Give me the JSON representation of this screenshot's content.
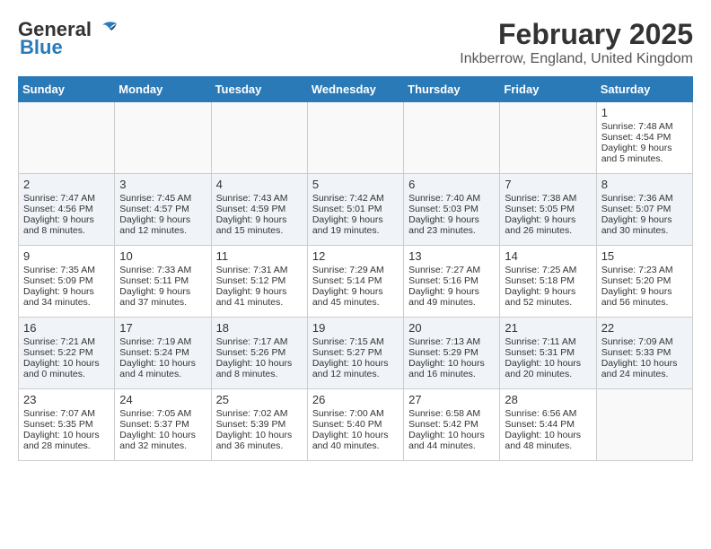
{
  "header": {
    "logo_general": "General",
    "logo_blue": "Blue",
    "title": "February 2025",
    "subtitle": "Inkberrow, England, United Kingdom"
  },
  "days_of_week": [
    "Sunday",
    "Monday",
    "Tuesday",
    "Wednesday",
    "Thursday",
    "Friday",
    "Saturday"
  ],
  "weeks": [
    [
      {
        "day": "",
        "empty": true
      },
      {
        "day": "",
        "empty": true
      },
      {
        "day": "",
        "empty": true
      },
      {
        "day": "",
        "empty": true
      },
      {
        "day": "",
        "empty": true
      },
      {
        "day": "",
        "empty": true
      },
      {
        "day": "1",
        "sunrise": "7:48 AM",
        "sunset": "4:54 PM",
        "daylight": "9 hours and 5 minutes."
      }
    ],
    [
      {
        "day": "2",
        "sunrise": "7:47 AM",
        "sunset": "4:56 PM",
        "daylight": "9 hours and 8 minutes."
      },
      {
        "day": "3",
        "sunrise": "7:45 AM",
        "sunset": "4:57 PM",
        "daylight": "9 hours and 12 minutes."
      },
      {
        "day": "4",
        "sunrise": "7:43 AM",
        "sunset": "4:59 PM",
        "daylight": "9 hours and 15 minutes."
      },
      {
        "day": "5",
        "sunrise": "7:42 AM",
        "sunset": "5:01 PM",
        "daylight": "9 hours and 19 minutes."
      },
      {
        "day": "6",
        "sunrise": "7:40 AM",
        "sunset": "5:03 PM",
        "daylight": "9 hours and 23 minutes."
      },
      {
        "day": "7",
        "sunrise": "7:38 AM",
        "sunset": "5:05 PM",
        "daylight": "9 hours and 26 minutes."
      },
      {
        "day": "8",
        "sunrise": "7:36 AM",
        "sunset": "5:07 PM",
        "daylight": "9 hours and 30 minutes."
      }
    ],
    [
      {
        "day": "9",
        "sunrise": "7:35 AM",
        "sunset": "5:09 PM",
        "daylight": "9 hours and 34 minutes."
      },
      {
        "day": "10",
        "sunrise": "7:33 AM",
        "sunset": "5:11 PM",
        "daylight": "9 hours and 37 minutes."
      },
      {
        "day": "11",
        "sunrise": "7:31 AM",
        "sunset": "5:12 PM",
        "daylight": "9 hours and 41 minutes."
      },
      {
        "day": "12",
        "sunrise": "7:29 AM",
        "sunset": "5:14 PM",
        "daylight": "9 hours and 45 minutes."
      },
      {
        "day": "13",
        "sunrise": "7:27 AM",
        "sunset": "5:16 PM",
        "daylight": "9 hours and 49 minutes."
      },
      {
        "day": "14",
        "sunrise": "7:25 AM",
        "sunset": "5:18 PM",
        "daylight": "9 hours and 52 minutes."
      },
      {
        "day": "15",
        "sunrise": "7:23 AM",
        "sunset": "5:20 PM",
        "daylight": "9 hours and 56 minutes."
      }
    ],
    [
      {
        "day": "16",
        "sunrise": "7:21 AM",
        "sunset": "5:22 PM",
        "daylight": "10 hours and 0 minutes."
      },
      {
        "day": "17",
        "sunrise": "7:19 AM",
        "sunset": "5:24 PM",
        "daylight": "10 hours and 4 minutes."
      },
      {
        "day": "18",
        "sunrise": "7:17 AM",
        "sunset": "5:26 PM",
        "daylight": "10 hours and 8 minutes."
      },
      {
        "day": "19",
        "sunrise": "7:15 AM",
        "sunset": "5:27 PM",
        "daylight": "10 hours and 12 minutes."
      },
      {
        "day": "20",
        "sunrise": "7:13 AM",
        "sunset": "5:29 PM",
        "daylight": "10 hours and 16 minutes."
      },
      {
        "day": "21",
        "sunrise": "7:11 AM",
        "sunset": "5:31 PM",
        "daylight": "10 hours and 20 minutes."
      },
      {
        "day": "22",
        "sunrise": "7:09 AM",
        "sunset": "5:33 PM",
        "daylight": "10 hours and 24 minutes."
      }
    ],
    [
      {
        "day": "23",
        "sunrise": "7:07 AM",
        "sunset": "5:35 PM",
        "daylight": "10 hours and 28 minutes."
      },
      {
        "day": "24",
        "sunrise": "7:05 AM",
        "sunset": "5:37 PM",
        "daylight": "10 hours and 32 minutes."
      },
      {
        "day": "25",
        "sunrise": "7:02 AM",
        "sunset": "5:39 PM",
        "daylight": "10 hours and 36 minutes."
      },
      {
        "day": "26",
        "sunrise": "7:00 AM",
        "sunset": "5:40 PM",
        "daylight": "10 hours and 40 minutes."
      },
      {
        "day": "27",
        "sunrise": "6:58 AM",
        "sunset": "5:42 PM",
        "daylight": "10 hours and 44 minutes."
      },
      {
        "day": "28",
        "sunrise": "6:56 AM",
        "sunset": "5:44 PM",
        "daylight": "10 hours and 48 minutes."
      },
      {
        "day": "",
        "empty": true
      }
    ]
  ],
  "labels": {
    "sunrise_prefix": "Sunrise: ",
    "sunset_prefix": "Sunset: ",
    "daylight_prefix": "Daylight: "
  }
}
